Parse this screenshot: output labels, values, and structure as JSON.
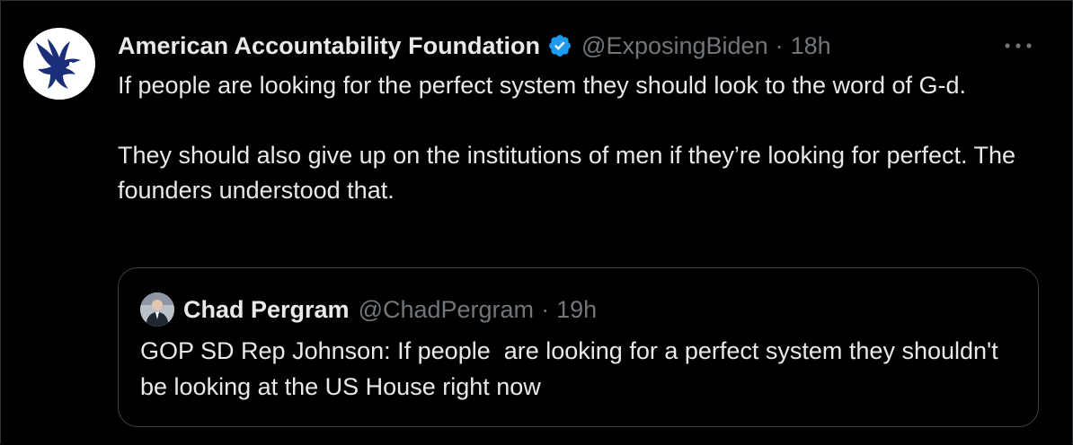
{
  "tweet": {
    "display_name": "American Accountability Foundation",
    "handle": "@ExposingBiden",
    "separator": "·",
    "time": "18h",
    "verified_color": "#1d9bf0",
    "text_paragraphs": [
      "If people are looking for the perfect system they should look to the word of G-d.",
      "They should also give up on the institutions of men if they’re looking for perfect. The founders understood that."
    ],
    "avatar_icon": "eagle-logo-icon",
    "more_icon": "more-horizontal-icon"
  },
  "quote": {
    "display_name": "Chad Pergram",
    "handle": "@ChadPergram",
    "separator": "·",
    "time": "19h",
    "text": "GOP SD Rep Johnson: If people  are looking for a perfect system they shouldn't be looking at the US House right now",
    "avatar_icon": "person-photo-icon"
  },
  "colors": {
    "background": "#000000",
    "primary_text": "#e7e9ea",
    "secondary_text": "#71767b",
    "border": "#3e4144",
    "avatar_logo": "#1a2f78"
  }
}
